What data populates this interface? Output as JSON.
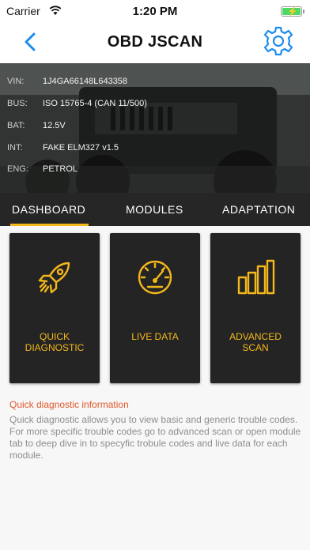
{
  "status_bar": {
    "carrier": "Carrier",
    "time": "1:20 PM",
    "wifi_icon": "wifi-icon",
    "battery_icon": "battery-charging-icon"
  },
  "nav": {
    "title": "OBD JSCAN",
    "back_icon": "chevron-left-icon",
    "settings_icon": "gear-icon"
  },
  "vehicle_info": [
    {
      "label": "VIN:",
      "value": "1J4GA66148L643358"
    },
    {
      "label": "BUS:",
      "value": "ISO 15765-4 (CAN 11/500)"
    },
    {
      "label": "BAT:",
      "value": "12.5V"
    },
    {
      "label": "INT:",
      "value": "FAKE ELM327 v1.5"
    },
    {
      "label": "ENG:",
      "value": "PETROL"
    }
  ],
  "tabs": [
    {
      "label": "DASHBOARD",
      "selected": true
    },
    {
      "label": "MODULES",
      "selected": false
    },
    {
      "label": "ADAPTATION",
      "selected": false
    }
  ],
  "cards": [
    {
      "label": "QUICK DIAGNOSTIC",
      "icon": "rocket-icon"
    },
    {
      "label": "LIVE DATA",
      "icon": "speedometer-icon"
    },
    {
      "label": "ADVANCED SCAN",
      "icon": "bar-chart-icon"
    }
  ],
  "info": {
    "title": "Quick diagnostic information",
    "body": "Quick diagnostic allows you to view basic and generic trouble codes. For more specific trouble codes go to advanced scan or open module tab to deep dive in to specyfic trobule codes and live data for each module."
  },
  "colors": {
    "accent": "#f5b81b",
    "tab_bar": "#262626",
    "card_bg": "#242424",
    "info_title": "#e0582c",
    "ios_blue": "#1a8cf0"
  }
}
